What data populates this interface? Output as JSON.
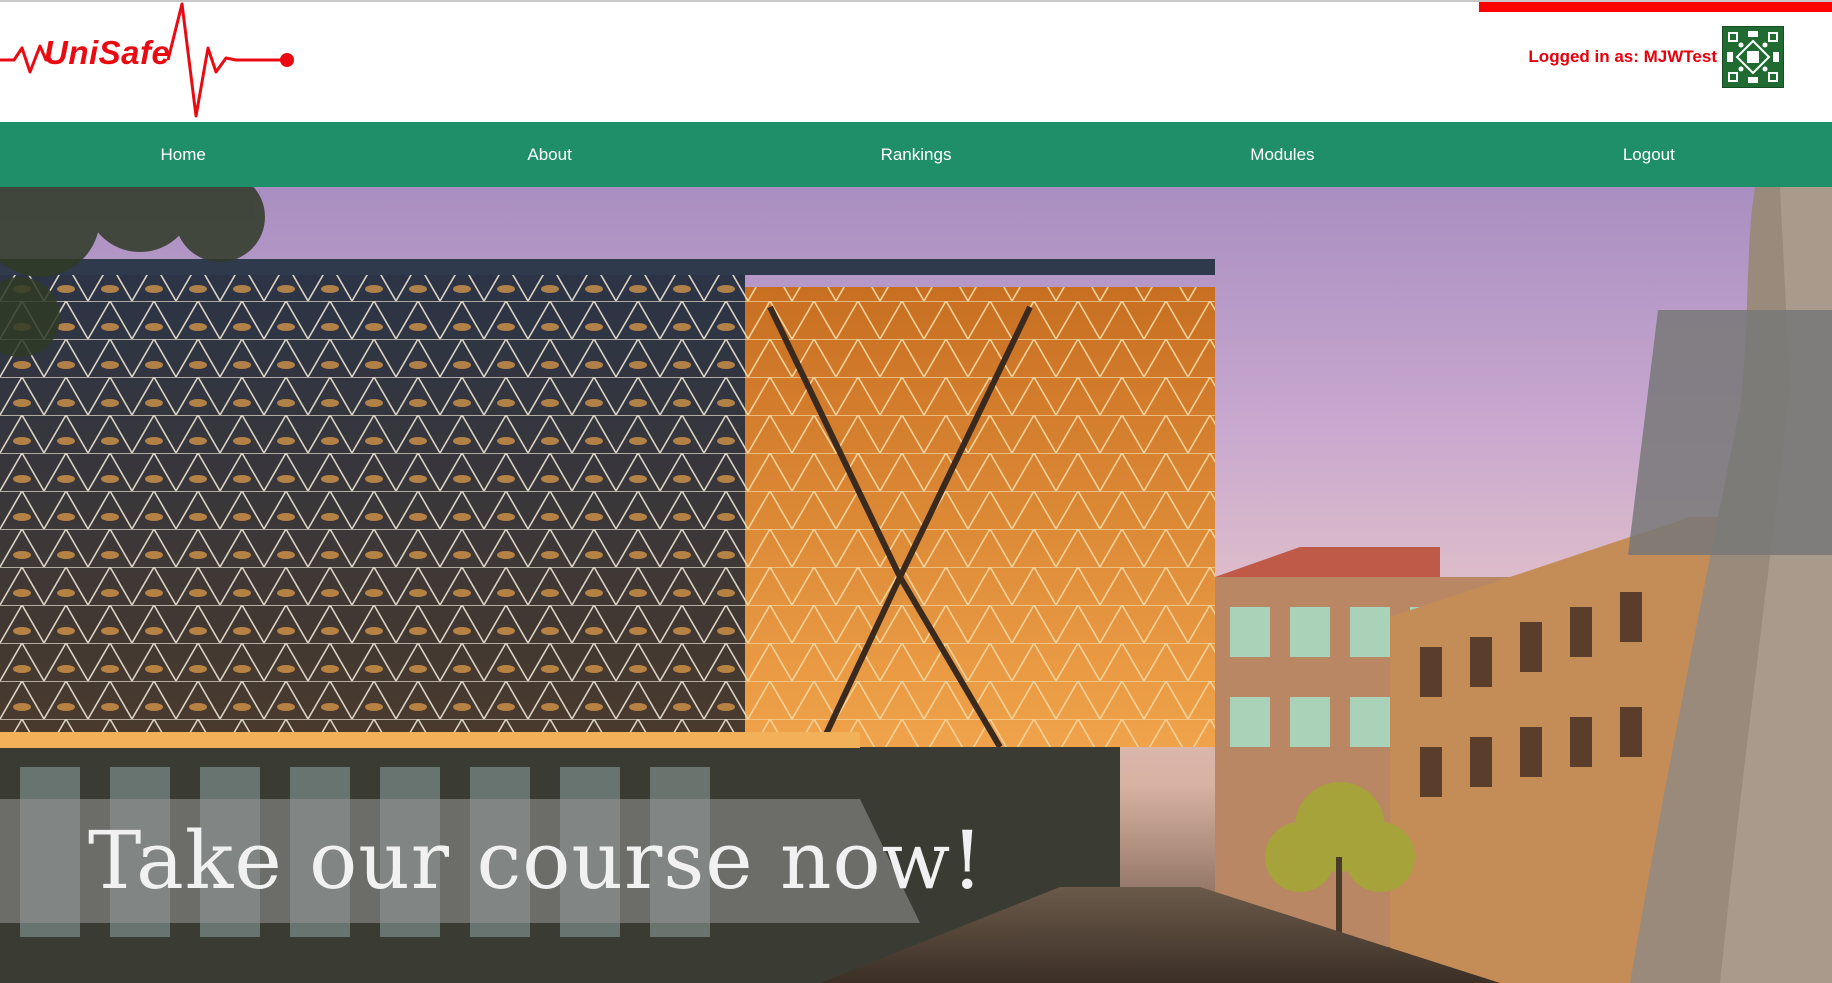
{
  "brand": {
    "name": "UniSafe",
    "color": "#ea0b12",
    "accent": "#ff0000"
  },
  "header": {
    "login_text": "Logged in as: MJWTest",
    "avatar_icon": "quilt-avatar-icon"
  },
  "nav": {
    "background": "#1e8f68",
    "items": [
      {
        "label": "Home"
      },
      {
        "label": "About"
      },
      {
        "label": "Rankings"
      },
      {
        "label": "Modules"
      },
      {
        "label": "Logout"
      }
    ]
  },
  "hero": {
    "caption": "Take our course now!"
  }
}
